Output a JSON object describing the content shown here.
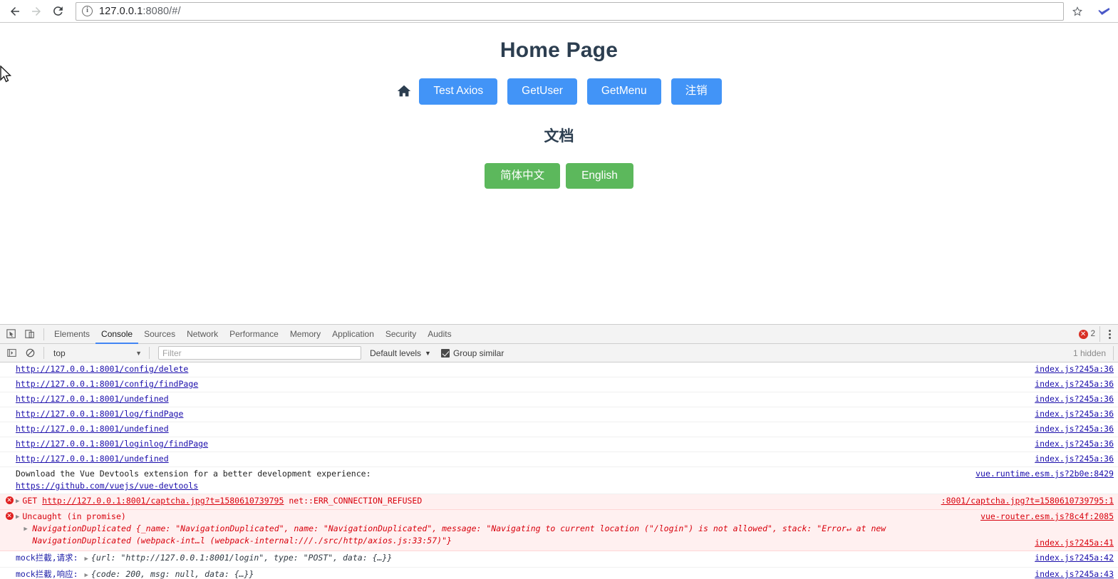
{
  "browser": {
    "back_icon": "arrow-left-icon",
    "forward_icon": "arrow-right-icon",
    "reload_icon": "reload-icon",
    "info_icon_label": "i",
    "url_host": "127.0.0.1",
    "url_rest": ":8080/#/",
    "url_full": "127.0.0.1:8080/#/",
    "bookmark_icon": "star-icon",
    "extension_icon": "extension-icon"
  },
  "page": {
    "title": "Home Page",
    "home_icon": "home-icon",
    "actions": [
      {
        "label": "Test Axios",
        "style": "primary"
      },
      {
        "label": "GetUser",
        "style": "primary"
      },
      {
        "label": "GetMenu",
        "style": "primary"
      },
      {
        "label": "注销",
        "style": "primary"
      }
    ],
    "doc_title": "文档",
    "lang_buttons": [
      {
        "label": "简体中文",
        "style": "success"
      },
      {
        "label": "English",
        "style": "success"
      }
    ],
    "colors": {
      "primary": "#4294f7",
      "success": "#5cb85c",
      "heading": "#2c3e50"
    }
  },
  "devtools": {
    "inspect_icon": "inspect-element-icon",
    "device_icon": "device-toolbar-icon",
    "tabs": [
      {
        "label": "Elements",
        "active": false
      },
      {
        "label": "Console",
        "active": true
      },
      {
        "label": "Sources",
        "active": false
      },
      {
        "label": "Network",
        "active": false
      },
      {
        "label": "Performance",
        "active": false
      },
      {
        "label": "Memory",
        "active": false
      },
      {
        "label": "Application",
        "active": false
      },
      {
        "label": "Security",
        "active": false
      },
      {
        "label": "Audits",
        "active": false
      }
    ],
    "error_count": "2",
    "error_badge_icon": "error-circle-icon",
    "more_icon": "kebab-menu-icon",
    "toolbar": {
      "sidebar_icon": "console-sidebar-icon",
      "clear_icon": "clear-console-icon",
      "context": "top",
      "context_caret": "▼",
      "filter_value": "",
      "filter_placeholder": "Filter",
      "levels_label": "Default levels",
      "levels_caret": "▼",
      "group_similar_label": "Group similar",
      "group_similar_checked": true,
      "hidden_label": "1 hidden"
    },
    "log": [
      {
        "kind": "link",
        "text": "http://127.0.0.1:8001/config/delete",
        "source": "index.js?245a:36"
      },
      {
        "kind": "link",
        "text": "http://127.0.0.1:8001/config/findPage",
        "source": "index.js?245a:36"
      },
      {
        "kind": "link",
        "text": "http://127.0.0.1:8001/undefined",
        "source": "index.js?245a:36"
      },
      {
        "kind": "link",
        "text": "http://127.0.0.1:8001/log/findPage",
        "source": "index.js?245a:36"
      },
      {
        "kind": "link",
        "text": "http://127.0.0.1:8001/undefined",
        "source": "index.js?245a:36"
      },
      {
        "kind": "link",
        "text": "http://127.0.0.1:8001/loginlog/findPage",
        "source": "index.js?245a:36"
      },
      {
        "kind": "link",
        "text": "http://127.0.0.1:8001/undefined",
        "source": "index.js?245a:36"
      },
      {
        "kind": "devtools-hint",
        "text": "Download the Vue Devtools extension for a better development experience:",
        "link": "https://github.com/vuejs/vue-devtools",
        "source": "vue.runtime.esm.js?2b0e:8429"
      },
      {
        "kind": "error-get",
        "method": "GET",
        "url": "http://127.0.0.1:8001/captcha.jpg?t=1580610739795",
        "status": "net::ERR_CONNECTION_REFUSED",
        "source": ":8001/captcha.jpg?t=1580610739795:1"
      },
      {
        "kind": "error-uncaught",
        "head": "Uncaught (in promise)",
        "body_prefix": "NavigationDuplicated ",
        "body": "{_name: \"NavigationDuplicated\", name: \"NavigationDuplicated\", message: \"Navigating to current location (\"/login\") is not allowed\", stack: \"Error↵    at new NavigationDuplicated (webpack-int…l (webpack-internal:///./src/http/axios.js:33:57)\"}",
        "source": "vue-router.esm.js?8c4f:2085",
        "source2": "index.js?245a:41"
      },
      {
        "kind": "mock",
        "label": "mock拦截,请求:",
        "body": "{url: \"http://127.0.0.1:8001/login\", type: \"POST\", data: {…}}",
        "source": "index.js?245a:42"
      },
      {
        "kind": "mock",
        "label": "mock拦截,响应:",
        "body": "{code: 200, msg: null, data: {…}}",
        "source": "index.js?245a:43"
      }
    ]
  }
}
